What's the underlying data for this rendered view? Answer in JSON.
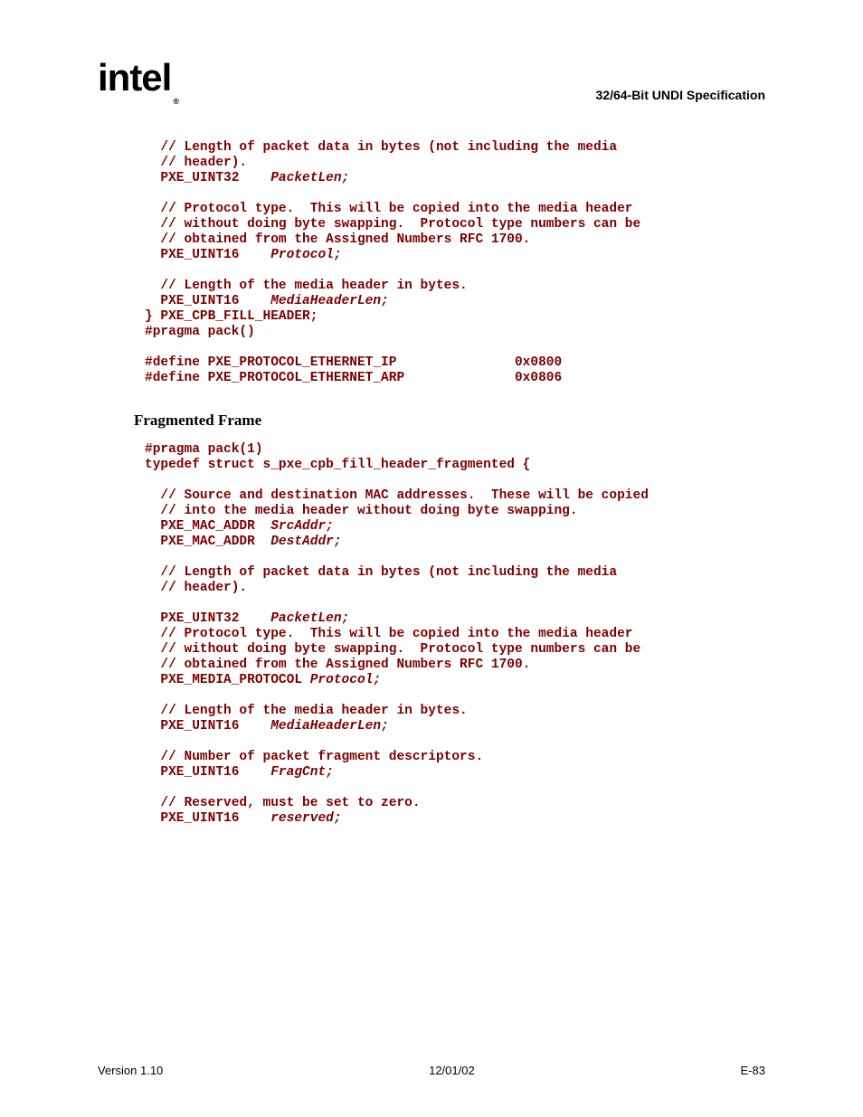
{
  "header": {
    "logo_text": "intel",
    "logo_reg": "®",
    "doc_title": "32/64-Bit UNDI Specification"
  },
  "code1": {
    "c1": "  // Length of packet data in bytes (not including the media",
    "c2": "  // header).",
    "l3a": "  PXE_UINT32    ",
    "l3b": "PacketLen;",
    "c4": "  // Protocol type.  This will be copied into the media header",
    "c5": "  // without doing byte swapping.  Protocol type numbers can be",
    "c6": "  // obtained from the Assigned Numbers RFC 1700.",
    "l7a": "  PXE_UINT16    ",
    "l7b": "Protocol;",
    "c8": "  // Length of the media header in bytes.",
    "l9a": "  PXE_UINT16    ",
    "l9b": "MediaHeaderLen;",
    "l10": "} PXE_CPB_FILL_HEADER;",
    "l11": "#pragma pack()",
    "l12": "#define PXE_PROTOCOL_ETHERNET_IP               0x0800",
    "l13": "#define PXE_PROTOCOL_ETHERNET_ARP              0x0806"
  },
  "section_heading": "Fragmented Frame",
  "code2": {
    "l1": "#pragma pack(1)",
    "l2": "typedef struct s_pxe_cpb_fill_header_fragmented {",
    "c3": "  // Source and destination MAC addresses.  These will be copied",
    "c4": "  // into the media header without doing byte swapping.",
    "l5a": "  PXE_MAC_ADDR  ",
    "l5b": "SrcAddr;",
    "l6a": "  PXE_MAC_ADDR  ",
    "l6b": "DestAddr;",
    "c7": "  // Length of packet data in bytes (not including the media",
    "c8": "  // header).",
    "l9a": "  PXE_UINT32    ",
    "l9b": "PacketLen;",
    "c10": "  // Protocol type.  This will be copied into the media header",
    "c11": "  // without doing byte swapping.  Protocol type numbers can be",
    "c12": "  // obtained from the Assigned Numbers RFC 1700.",
    "l13a": "  PXE_MEDIA_PROTOCOL ",
    "l13b": "Protocol;",
    "c14": "  // Length of the media header in bytes.",
    "l15a": "  PXE_UINT16    ",
    "l15b": "MediaHeaderLen;",
    "c16": "  // Number of packet fragment descriptors.",
    "l17a": "  PXE_UINT16    ",
    "l17b": "FragCnt;",
    "c18": "  // Reserved, must be set to zero.",
    "l19a": "  PXE_UINT16    ",
    "l19b": "reserved;"
  },
  "footer": {
    "left": "Version 1.10",
    "center": "12/01/02",
    "right": "E-83"
  }
}
